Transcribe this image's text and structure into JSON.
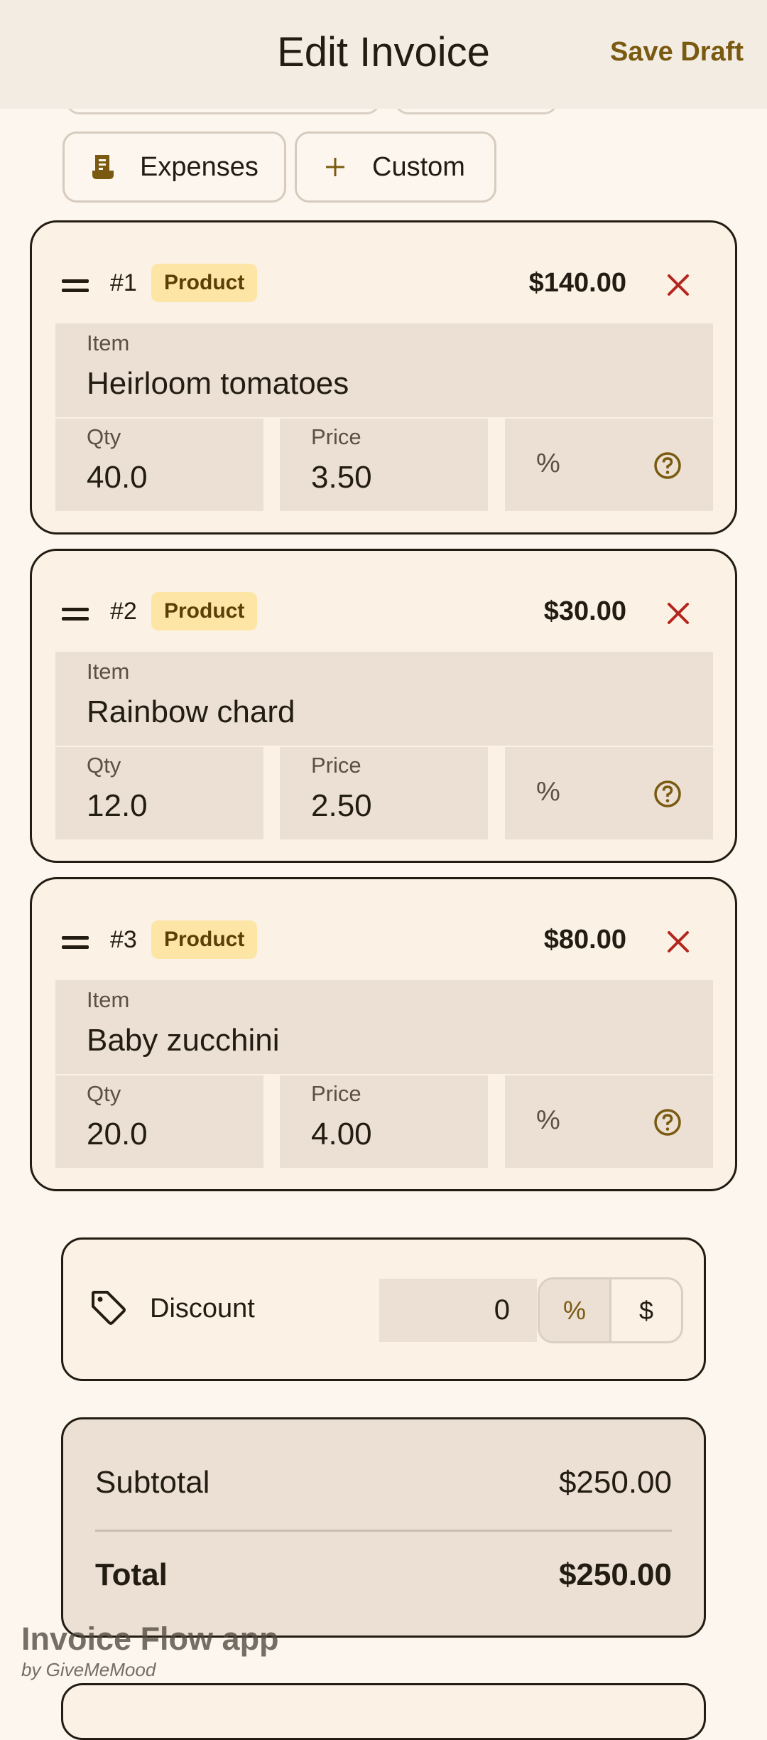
{
  "header": {
    "title": "Edit Invoice",
    "save_label": "Save Draft"
  },
  "chips": [
    {
      "label": "Expenses",
      "icon": "receipt-icon"
    },
    {
      "label": "Custom",
      "icon": "plus-icon"
    }
  ],
  "items": [
    {
      "num": "#1",
      "badge": "Product",
      "amount": "$140.00",
      "item_label": "Item",
      "item": "Heirloom tomatoes",
      "qty_label": "Qty",
      "qty": "40.0",
      "price_label": "Price",
      "price": "3.50",
      "pct": "%"
    },
    {
      "num": "#2",
      "badge": "Product",
      "amount": "$30.00",
      "item_label": "Item",
      "item": "Rainbow chard",
      "qty_label": "Qty",
      "qty": "12.0",
      "price_label": "Price",
      "price": "2.50",
      "pct": "%"
    },
    {
      "num": "#3",
      "badge": "Product",
      "amount": "$80.00",
      "item_label": "Item",
      "item": "Baby zucchini",
      "qty_label": "Qty",
      "qty": "20.0",
      "price_label": "Price",
      "price": "4.00",
      "pct": "%"
    }
  ],
  "discount": {
    "label": "Discount",
    "value": "0",
    "opt_percent": "%",
    "opt_dollar": "$",
    "selected": "%"
  },
  "summary": {
    "subtotal_label": "Subtotal",
    "subtotal": "$250.00",
    "total_label": "Total",
    "total": "$250.00"
  },
  "watermark": {
    "app": "Invoice Flow app",
    "by": "by GiveMeMood"
  },
  "colors": {
    "accent": "#7a5a10",
    "delete": "#b3261e",
    "badge_bg": "#fde5a5"
  }
}
